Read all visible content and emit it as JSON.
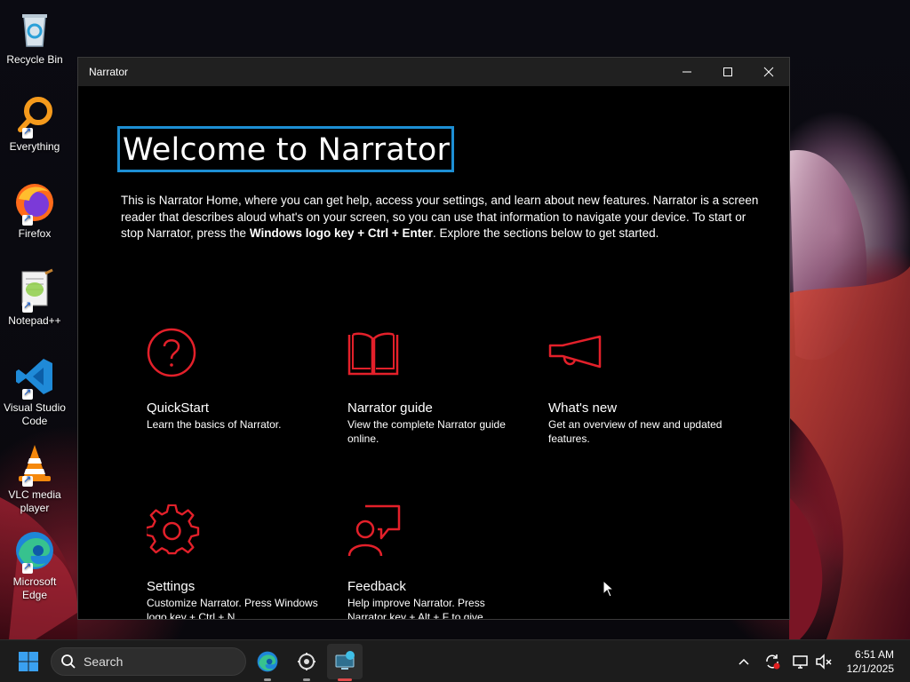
{
  "desktop": {
    "icons": [
      {
        "label": "Recycle Bin"
      },
      {
        "label": "Everything"
      },
      {
        "label": "Firefox"
      },
      {
        "label": "Notepad++"
      },
      {
        "label": "Visual Studio Code"
      },
      {
        "label": "VLC media player"
      },
      {
        "label": "Microsoft Edge"
      }
    ]
  },
  "window": {
    "title": "Narrator",
    "heading": "Welcome to Narrator",
    "intro_part1": "This is Narrator Home, where you can get help, access your settings, and learn about new features. Narrator is a screen reader that describes aloud what's on your screen, so you can use that information to navigate your device. To start or stop Narrator, press the ",
    "intro_bold": "Windows logo key + Ctrl + Enter",
    "intro_part2": ". Explore the sections below to get started.",
    "cards": [
      {
        "title": "QuickStart",
        "desc": "Learn the basics of Narrator."
      },
      {
        "title": "Narrator guide",
        "desc": "View the complete Narrator guide online."
      },
      {
        "title": "What's new",
        "desc": "Get an overview of new and updated features."
      },
      {
        "title": "Settings",
        "desc": "Customize Narrator. Press Windows logo key + Ctrl + N"
      },
      {
        "title": "Feedback",
        "desc": "Help improve Narrator. Press Narrator key + Alt + F to give"
      }
    ],
    "accent_color": "#e3202a"
  },
  "taskbar": {
    "search_label": "Search",
    "time": "6:51 AM",
    "date": "12/1/2025"
  }
}
